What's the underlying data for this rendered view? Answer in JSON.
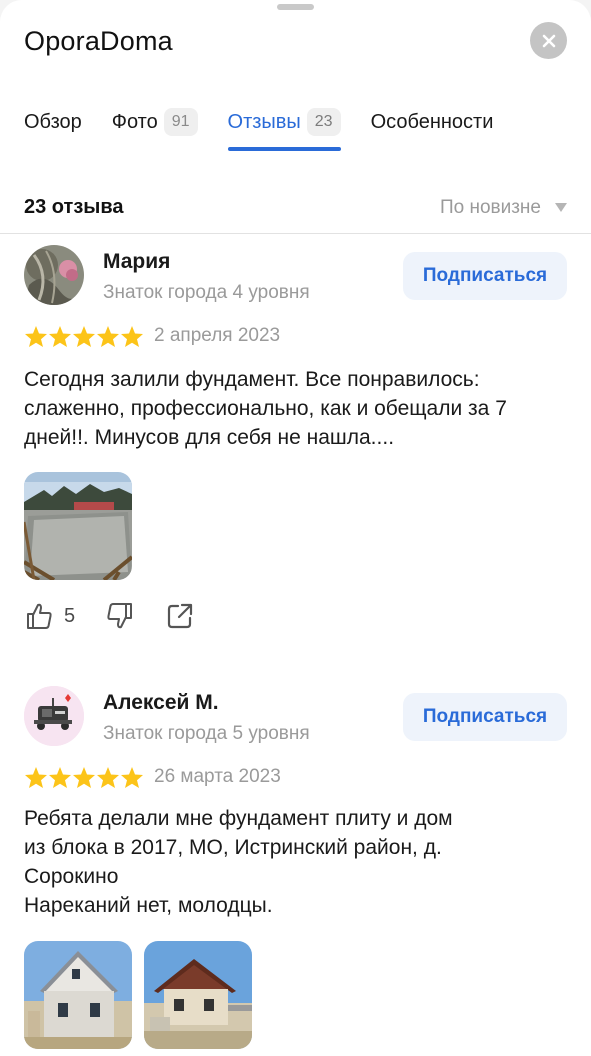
{
  "app": {
    "title": "OporaDoma"
  },
  "tabs": [
    {
      "label": "Обзор",
      "count": ""
    },
    {
      "label": "Фото",
      "count": "91"
    },
    {
      "label": "Отзывы",
      "count": "23"
    },
    {
      "label": "Особенности",
      "count": ""
    }
  ],
  "active_tab": "Отзывы",
  "summary": {
    "count_label": "23 отзыва",
    "sort_label": "По новизне"
  },
  "colors": {
    "accent": "#2a6bd8",
    "star": "#fcc419",
    "muted": "#9a9a9a"
  },
  "reviews": [
    {
      "author": "Мария",
      "level": "Знаток города 4 уровня",
      "subscribe_label": "Подписаться",
      "rating": 5,
      "date": "2 апреля 2023",
      "text": "Сегодня залили фундамент. Все понравилось: слаженно, профессионально, как и обещали за 7 дней!!. Минусов для себя не нашла....",
      "likes": "5"
    },
    {
      "author": "Алексей М.",
      "level": "Знаток города 5 уровня",
      "subscribe_label": "Подписаться",
      "rating": 5,
      "date": "26 марта 2023",
      "text": "Ребята делали мне фундамент плиту и дом\nиз блока в 2017, МО, Истринский район, д.\nСорокино\nНареканий нет, молодцы.",
      "likes": ""
    }
  ]
}
